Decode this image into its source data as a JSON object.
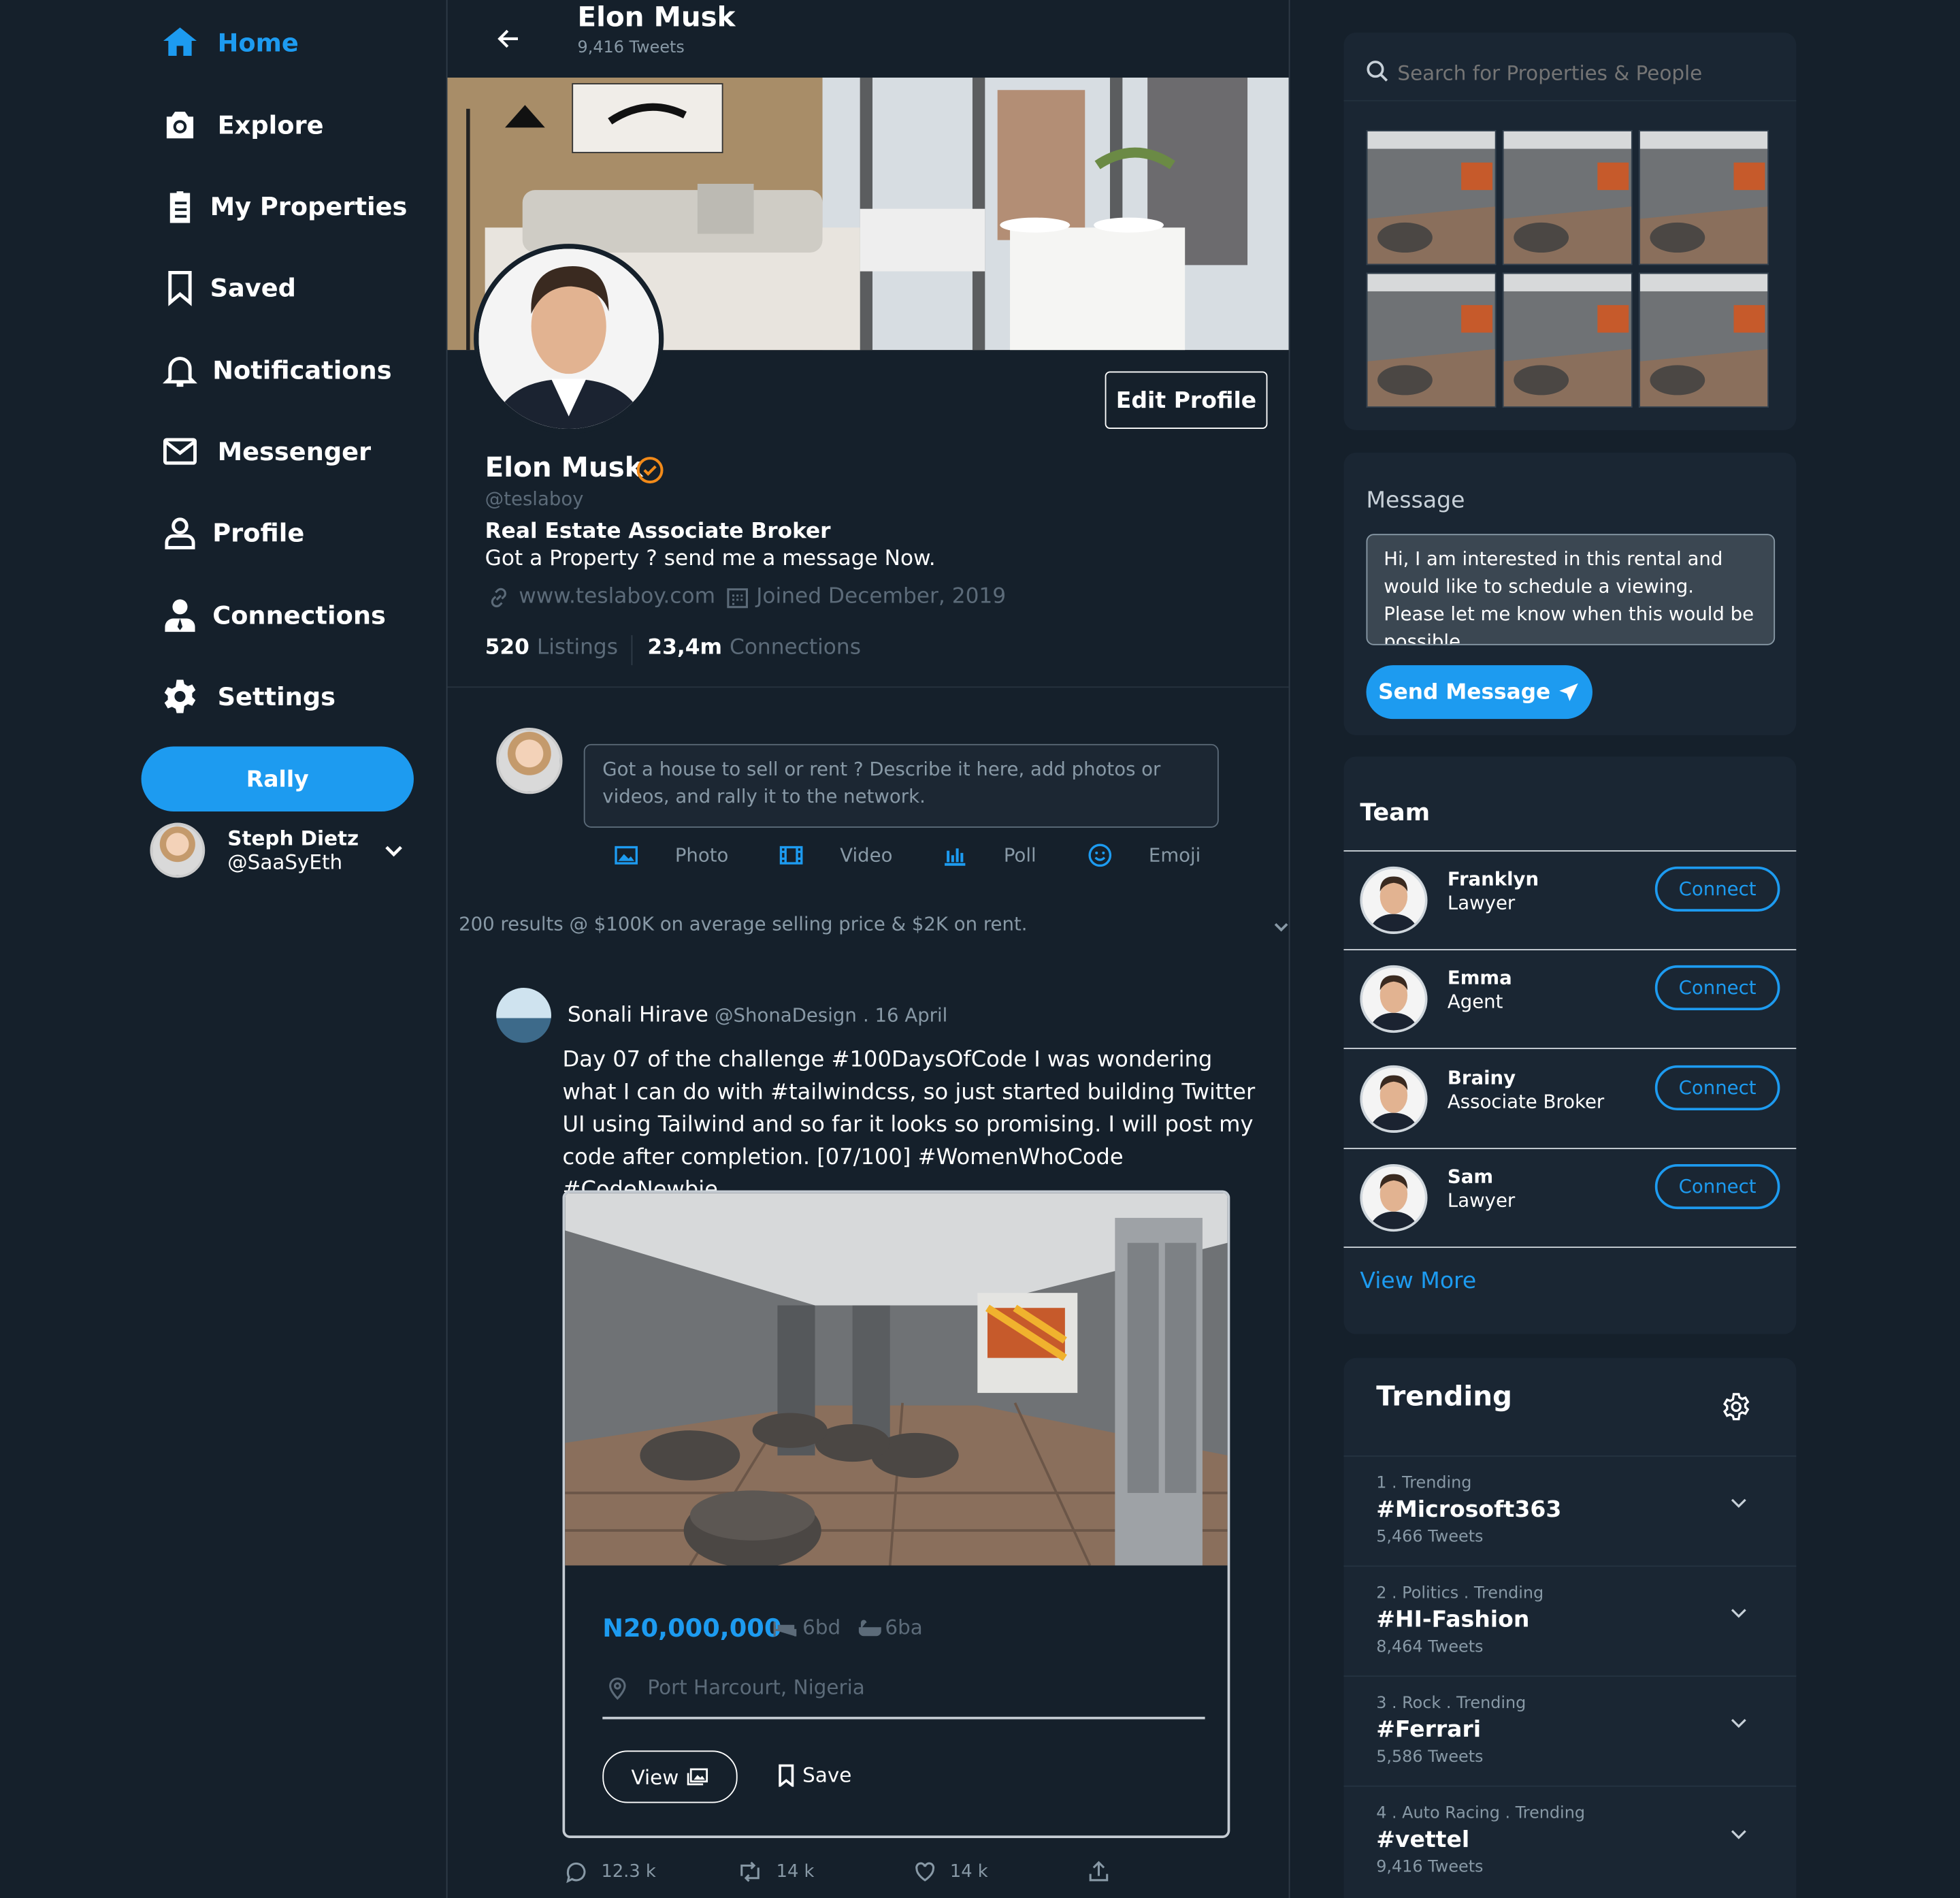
{
  "nav": {
    "items": [
      {
        "label": "Home",
        "icon": "home-icon",
        "active": true
      },
      {
        "label": "Explore",
        "icon": "camera-icon"
      },
      {
        "label": "My Properties",
        "icon": "clipboard-icon"
      },
      {
        "label": "Saved",
        "icon": "bookmark-icon"
      },
      {
        "label": "Notifications",
        "icon": "bell-icon"
      },
      {
        "label": "Messenger",
        "icon": "mail-icon"
      },
      {
        "label": "Profile",
        "icon": "user-icon"
      },
      {
        "label": "Connections",
        "icon": "user-tie-icon"
      },
      {
        "label": "Settings",
        "icon": "gear-icon"
      }
    ],
    "rally_label": "Rally",
    "account": {
      "name": "Steph Dietz",
      "handle": "@SaaSyEth"
    }
  },
  "header": {
    "title": "Elon Musk",
    "tweet_count": "9,416 Tweets"
  },
  "profile": {
    "edit_label": "Edit Profile",
    "name": "Elon Musk",
    "handle": "@teslaboy",
    "role": "Real Estate Associate Broker",
    "bio": "Got a Property ? send me a message Now.",
    "website": "www.teslaboy.com",
    "joined": "Joined December, 2019",
    "listings_count": "520",
    "listings_label": "Listings",
    "connections_count": "23,4m",
    "connections_label": "Connections"
  },
  "composer": {
    "placeholder": "Got a house to sell or rent ? Describe it here, add photos or videos, and rally it to the network.",
    "actions": [
      "Photo",
      "Video",
      "Poll",
      "Emoji"
    ]
  },
  "results_summary": "200 results @ $100K on average selling price & $2K on rent.",
  "post": {
    "author": "Sonali Hirave",
    "handle": "@ShonaDesign",
    "date": ". 16 April",
    "text": "Day 07 of the challenge #100DaysOfCode I was wondering what I can do with #tailwindcss, so just started building Twitter UI using Tailwind and so far it looks so promising. I will post my code after completion. [07/100] #WomenWhoCode #CodeNewbie",
    "price": "N20,000,000",
    "beds": "6bd",
    "baths": "6ba",
    "location": "Port Harcourt, Nigeria",
    "view_label": "View",
    "save_label": "Save",
    "replies": "12.3 k",
    "retweets": "14 k",
    "likes": "14 k"
  },
  "search": {
    "placeholder": "Search for Properties & People"
  },
  "message": {
    "title": "Message",
    "body": "Hi, I am interested in this rental and would like to schedule a viewing. Please let me know when this would be possible",
    "send_label": "Send Message"
  },
  "team": {
    "title": "Team",
    "members": [
      {
        "name": "Franklyn",
        "role": "Lawyer",
        "action": "Connect"
      },
      {
        "name": "Emma",
        "role": "Agent",
        "action": "Connect"
      },
      {
        "name": "Brainy",
        "role": "Associate Broker",
        "action": "Connect"
      },
      {
        "name": "Sam",
        "role": "Lawyer",
        "action": "Connect"
      }
    ],
    "view_more": "View More"
  },
  "trending": {
    "title": "Trending",
    "items": [
      {
        "context": "1 . Trending",
        "tag": "#Microsoft363",
        "count": "5,466 Tweets"
      },
      {
        "context": "2 . Politics . Trending",
        "tag": "#HI-Fashion",
        "count": "8,464 Tweets"
      },
      {
        "context": "3 . Rock . Trending",
        "tag": "#Ferrari",
        "count": "5,586 Tweets"
      },
      {
        "context": "4 . Auto Racing . Trending",
        "tag": "#vettel",
        "count": "9,416 Tweets"
      }
    ]
  },
  "colors": {
    "background": "#15202b",
    "accent": "#1d9bf0",
    "panel": "#1a2633"
  }
}
